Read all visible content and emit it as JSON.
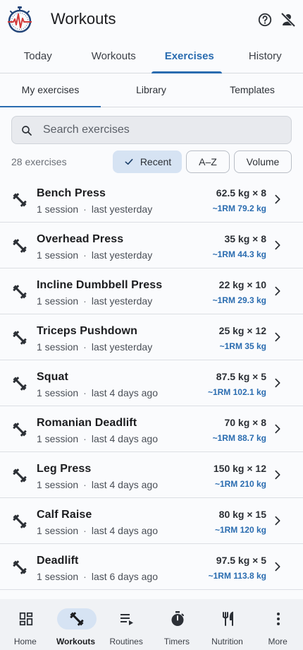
{
  "appbar": {
    "title": "Workouts",
    "logo_icon": "stopwatch-heartbeat-logo",
    "help_icon": "help-circle-icon",
    "profile_icon": "person-off-icon"
  },
  "primary_tabs": [
    {
      "label": "Today",
      "active": false
    },
    {
      "label": "Workouts",
      "active": false
    },
    {
      "label": "Exercises",
      "active": true
    },
    {
      "label": "History",
      "active": false
    }
  ],
  "secondary_tabs": [
    {
      "label": "My exercises",
      "active": true
    },
    {
      "label": "Library",
      "active": false
    },
    {
      "label": "Templates",
      "active": false
    }
  ],
  "search": {
    "placeholder": "Search exercises",
    "value": ""
  },
  "filter": {
    "count": "28 exercises",
    "sort_options": [
      {
        "label": "Recent",
        "selected": true
      },
      {
        "label": "A–Z",
        "selected": false
      },
      {
        "label": "Volume",
        "selected": false
      }
    ]
  },
  "exercises": [
    {
      "name": "Bench Press",
      "sessions": "1 session",
      "last": "last yesterday",
      "best": "62.5 kg × 8",
      "one_rm": "~1RM 79.2 kg"
    },
    {
      "name": "Overhead Press",
      "sessions": "1 session",
      "last": "last yesterday",
      "best": "35 kg × 8",
      "one_rm": "~1RM 44.3 kg"
    },
    {
      "name": "Incline Dumbbell Press",
      "sessions": "1 session",
      "last": "last yesterday",
      "best": "22 kg × 10",
      "one_rm": "~1RM 29.3 kg"
    },
    {
      "name": "Triceps Pushdown",
      "sessions": "1 session",
      "last": "last yesterday",
      "best": "25 kg × 12",
      "one_rm": "~1RM 35 kg"
    },
    {
      "name": "Squat",
      "sessions": "1 session",
      "last": "last 4 days ago",
      "best": "87.5 kg × 5",
      "one_rm": "~1RM 102.1 kg"
    },
    {
      "name": "Romanian Deadlift",
      "sessions": "1 session",
      "last": "last 4 days ago",
      "best": "70 kg × 8",
      "one_rm": "~1RM 88.7 kg"
    },
    {
      "name": "Leg Press",
      "sessions": "1 session",
      "last": "last 4 days ago",
      "best": "150 kg × 12",
      "one_rm": "~1RM 210 kg"
    },
    {
      "name": "Calf Raise",
      "sessions": "1 session",
      "last": "last 4 days ago",
      "best": "80 kg × 15",
      "one_rm": "~1RM 120 kg"
    },
    {
      "name": "Deadlift",
      "sessions": "1 session",
      "last": "last 6 days ago",
      "best": "97.5 kg × 5",
      "one_rm": "~1RM 113.8 kg"
    }
  ],
  "bottom_nav": [
    {
      "label": "Home",
      "icon": "dashboard-icon",
      "active": false
    },
    {
      "label": "Workouts",
      "icon": "dumbbell-icon",
      "active": true
    },
    {
      "label": "Routines",
      "icon": "playlist-play-icon",
      "active": false
    },
    {
      "label": "Timers",
      "icon": "timer-icon",
      "active": false
    },
    {
      "label": "Nutrition",
      "icon": "fork-knife-icon",
      "active": false
    },
    {
      "label": "More",
      "icon": "more-vertical-icon",
      "active": false
    }
  ],
  "colors": {
    "accent": "#2a6cb0",
    "chip_selected": "#d6e3f3",
    "logo_red": "#d23a3a",
    "logo_navy": "#24467a"
  }
}
